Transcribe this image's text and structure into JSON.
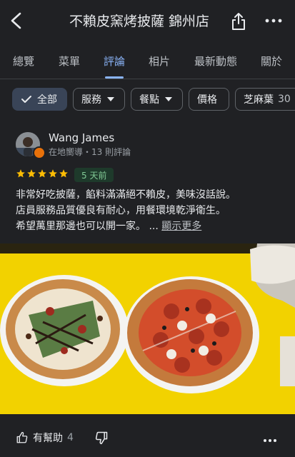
{
  "header": {
    "title": "不賴皮窯烤披薩 錦州店",
    "back_icon": "chevron-left-icon",
    "share_icon": "share-icon",
    "more_icon": "more-horizontal-icon"
  },
  "tabs": [
    {
      "label": "總覽",
      "active": false
    },
    {
      "label": "菜單",
      "active": false
    },
    {
      "label": "評論",
      "active": true
    },
    {
      "label": "相片",
      "active": false
    },
    {
      "label": "最新動態",
      "active": false
    },
    {
      "label": "關於",
      "active": false
    }
  ],
  "filters": {
    "all": "全部",
    "service": "服務",
    "meal": "餐點",
    "price": "價格",
    "topic": "芝麻葉",
    "topic_count": "30"
  },
  "review": {
    "author": "Wang James",
    "meta": "在地嚮導・13 則評論",
    "rating": 5,
    "date": "5 天前",
    "text_lines": [
      "非常好吃披薩，餡料滿滿絕不賴皮，美味沒話說。",
      "店員服務品質優良有耐心，用餐環境乾淨衛生。",
      "希望萬里那邊也可以開一家。 ..."
    ],
    "more_label": "顯示更多",
    "helpful_label": "有幫助",
    "helpful_count": "4"
  },
  "colors": {
    "accent": "#8ab4f8",
    "star": "#fbbc04",
    "badge_green": "#81c995",
    "guide_badge": "#e8710a",
    "table_yellow": "#f2d200"
  }
}
